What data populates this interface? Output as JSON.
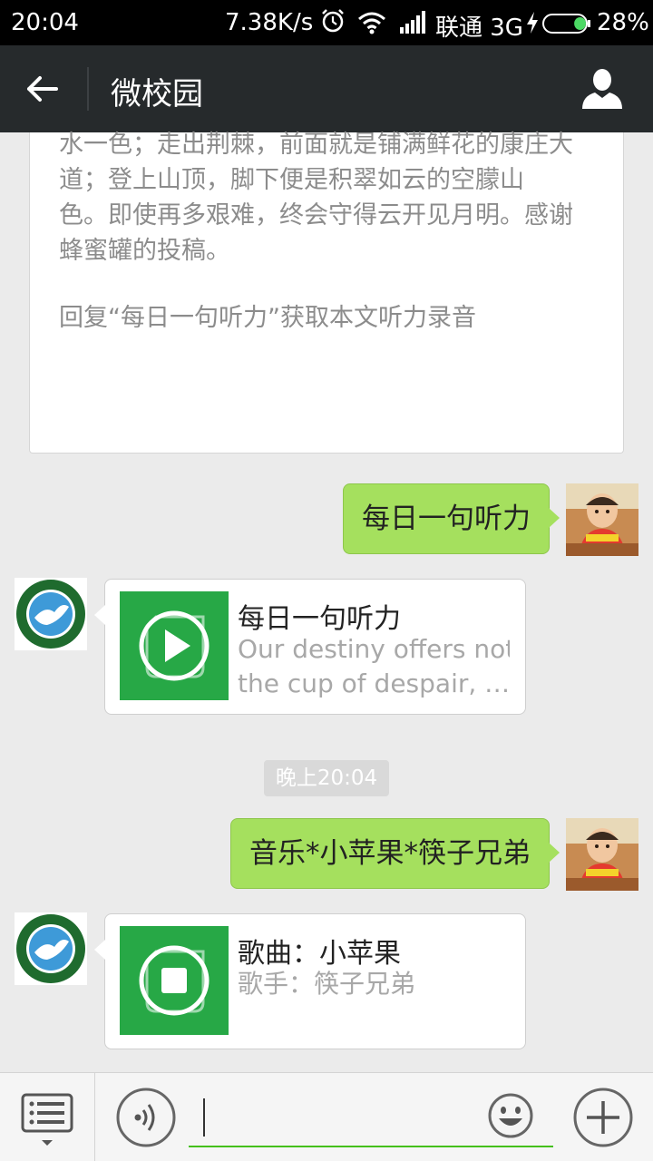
{
  "status_bar": {
    "time": "20:04",
    "speed": "7.38K/s",
    "carrier": "联通 3G",
    "battery_percent": "28%",
    "battery_level": 0.28,
    "icons": [
      "alarm-icon",
      "wifi-icon",
      "signal-icon",
      "charging-icon",
      "battery-icon"
    ]
  },
  "header": {
    "title": "微校园",
    "back_icon": "arrow-left-icon",
    "profile_icon": "person-icon"
  },
  "article": {
    "lines": [
      "水一色；走出荆棘，前面就是铺满鲜花的康庄大",
      "道；登上山顶，脚下便是积翠如云的空朦山",
      "色。即使再多艰难，终会守得云开见月明。感谢",
      "蜂蜜罐的投稿。"
    ],
    "reply_hint": "回复“每日一句听力”获取本文听力录音"
  },
  "messages": [
    {
      "type": "sent",
      "text": "每日一句听力"
    },
    {
      "type": "received-card",
      "title": "每日一句听力",
      "desc_line1": "Our destiny offers not",
      "desc_line2": "the cup of despair, …",
      "icon": "music-play-icon"
    },
    {
      "type": "time",
      "text": "晚上20:04"
    },
    {
      "type": "sent",
      "text": "音乐*小苹果*筷子兄弟"
    },
    {
      "type": "received-card",
      "title": "歌曲：小苹果",
      "desc_line1": "歌手：筷子兄弟",
      "icon": "music-stop-icon"
    }
  ],
  "input_bar": {
    "value": "",
    "placeholder": "",
    "icons": [
      "menu-list-icon",
      "voice-icon",
      "emoji-icon",
      "plus-icon"
    ]
  },
  "colors": {
    "sent_bubble": "#a5e05e",
    "header_bg": "#262a2c",
    "music_thumb": "#27a846",
    "input_underline": "#45c01a"
  }
}
